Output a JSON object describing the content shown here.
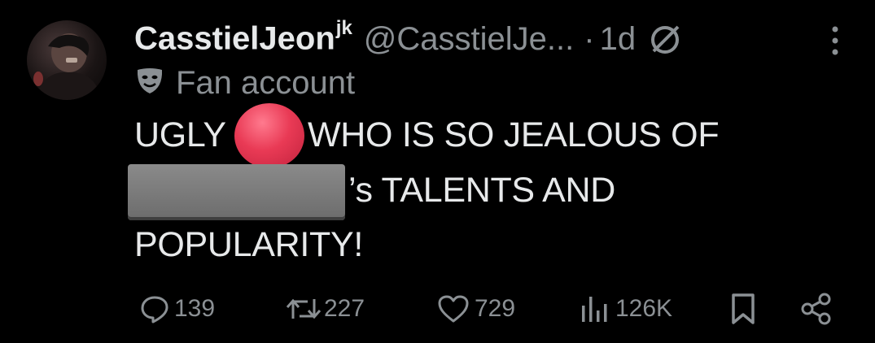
{
  "post": {
    "display_name": "CasstielJeon",
    "name_suffix": "jk",
    "handle": "@CasstielJe...",
    "separator": "·",
    "time": "1d",
    "label": "Fan account",
    "text_line1a": "UGLY",
    "text_line1b": "WHO IS SO JEALOUS OF",
    "text_line2": "’s TALENTS AND",
    "text_line3": "POPULARITY!",
    "icons": {
      "label": "drama-mask-icon",
      "no_symbol": "no-symbol-icon",
      "emoji": "red-circle-emoji"
    }
  },
  "actions": {
    "replies": "139",
    "reposts": "227",
    "likes": "729",
    "views": "126K"
  },
  "colors": {
    "background": "#000000",
    "text": "#e7e9ea",
    "muted": "#8b9094",
    "emoji": "#e93a55",
    "redaction": "#7a7a7a"
  }
}
